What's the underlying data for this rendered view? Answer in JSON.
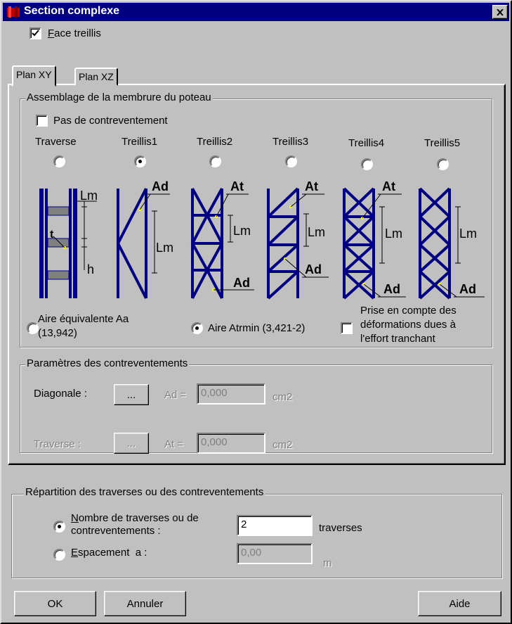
{
  "window": {
    "title": "Section complexe"
  },
  "face_treillis": {
    "label": "Face treillis",
    "checked": true
  },
  "tabs": [
    {
      "label": "Plan XY",
      "active": true
    },
    {
      "label": "Plan XZ",
      "active": false
    }
  ],
  "assemblage": {
    "legend": "Assemblage de la membrure du poteau",
    "pas_de_contreventement": {
      "label": "Pas de contreventement",
      "checked": false
    },
    "types": [
      {
        "label": "Traverse",
        "selected": false
      },
      {
        "label": "Treillis1",
        "selected": true
      },
      {
        "label": "Treillis2",
        "selected": false
      },
      {
        "label": "Treillis3",
        "selected": false
      },
      {
        "label": "Treillis4",
        "selected": false
      },
      {
        "label": "Treillis5",
        "selected": false
      }
    ],
    "diagram_labels": {
      "lm": "Lm",
      "h": "h",
      "t": "t",
      "ad": "Ad",
      "at": "At"
    },
    "aire_equivalente": {
      "line1": "Aire équivalente Aa",
      "line2": "(13,942)",
      "selected": false
    },
    "aire_atrmin": {
      "label": "Aire Atrmin (3,421-2)",
      "selected": true
    },
    "prise_en_compte": {
      "line1": "Prise en compte des",
      "line2": "déformations dues à",
      "line3": "l'effort tranchant",
      "checked": false
    }
  },
  "parametres": {
    "legend": "Paramètres des contreventements",
    "diagonale": {
      "label": "Diagonale :",
      "button": "...",
      "field_label": "Ad =",
      "value": "0,000",
      "unit": "cm2"
    },
    "traverse": {
      "label": "Traverse :",
      "button": "...",
      "field_label": "At =",
      "value": "0,000",
      "unit": "cm2"
    }
  },
  "repartition": {
    "legend": "Répartition des traverses ou des contreventements",
    "nombre": {
      "line1": "Nombre de traverses ou de",
      "line2": "contreventements :",
      "value": "2",
      "unit": "traverses",
      "selected": true
    },
    "espacement": {
      "label": "Espacement  a :",
      "value": "0,00",
      "unit": "m",
      "selected": false
    }
  },
  "buttons": {
    "ok": "OK",
    "annuler": "Annuler",
    "aide": "Aide"
  },
  "colors": {
    "structure": "#000080",
    "face": "#c0c0c0",
    "highlight": "#ffff00"
  }
}
